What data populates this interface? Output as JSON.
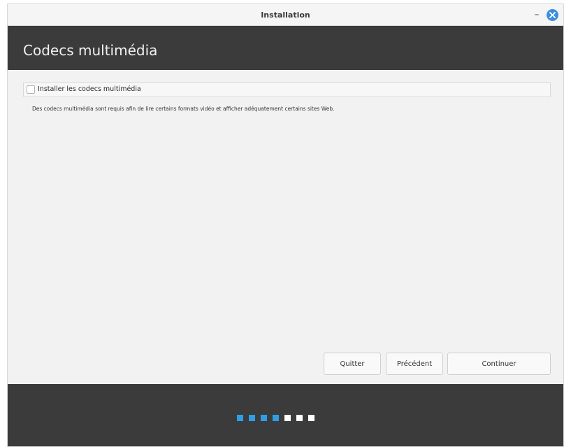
{
  "window": {
    "title": "Installation",
    "minimize_symbol": "–"
  },
  "header": {
    "title": "Codecs multimédia"
  },
  "option": {
    "label": "Installer les codecs multimédia",
    "checked": false
  },
  "description": "Des codecs multimédia sont requis afin de lire certains formats vidéo et afficher adéquatement certains sites Web.",
  "buttons": {
    "quit": "Quitter",
    "previous": "Précédent",
    "continue": "Continuer"
  },
  "progress": {
    "completed_steps": 4,
    "total_steps": 7
  },
  "colors": {
    "header_bg": "#3b3b3b",
    "accent": "#2f9ee6",
    "close_button": "#3d8ee0"
  },
  "icons": {
    "close": "close-icon",
    "minimize": "minimize-icon"
  }
}
